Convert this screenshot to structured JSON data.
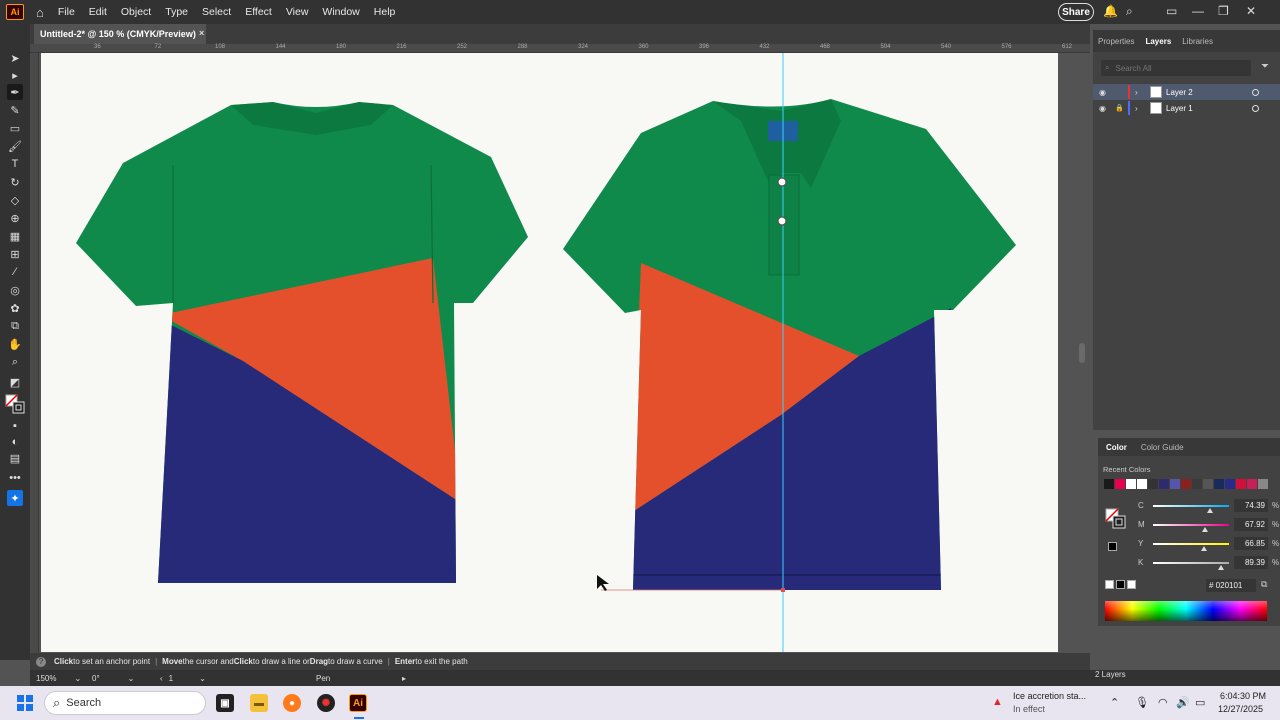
{
  "menubar": {
    "logo": "Ai",
    "items": [
      "File",
      "Edit",
      "Object",
      "Type",
      "Select",
      "Effect",
      "View",
      "Window",
      "Help"
    ],
    "share_label": "Share"
  },
  "document": {
    "tab_title": "Untitled-2* @ 150 % (CMYK/Preview)",
    "close_glyph": "×"
  },
  "ruler": {
    "ticks": [
      "36",
      "72",
      "108",
      "144",
      "180",
      "216",
      "252",
      "288",
      "324",
      "360",
      "396",
      "432",
      "468",
      "504",
      "540",
      "576",
      "612"
    ]
  },
  "hint": {
    "a1": "Click",
    "a2": " to set an anchor point",
    "b1": "Move",
    "b2": " the cursor and ",
    "b3": "Click",
    "b4": " to draw a line or ",
    "b5": "Drag",
    "b6": " to draw a curve",
    "c1": "Enter",
    "c2": " to exit the path",
    "sep": "|"
  },
  "statusbar": {
    "zoom": "150%",
    "rotation": "0°",
    "artboard": "1",
    "tool": "Pen"
  },
  "layers_panel": {
    "tabs": [
      "Properties",
      "Layers",
      "Libraries"
    ],
    "search_placeholder": "Search All",
    "layers": [
      {
        "name": "Layer 2",
        "color": "#e8323c"
      },
      {
        "name": "Layer 1",
        "color": "#4a6cff"
      }
    ],
    "count_label": "2 Layers"
  },
  "color_panel": {
    "tabs": [
      "Color",
      "Color Guide"
    ],
    "recent_label": "Recent Colors",
    "recent_swatches": [
      "#1a1a1a",
      "#e8004c",
      "#ffffff",
      "#ffffff",
      "#333333",
      "#2b2b6e",
      "#5555aa",
      "#8a2020",
      "#3a3a3a",
      "#555555",
      "#1a2a5a",
      "#2a2a8a",
      "#d0103a",
      "#c81e5a",
      "#888888"
    ],
    "sliders": [
      {
        "label": "C",
        "value": "74.39",
        "fraction": 0.7439,
        "track": "#00aeef"
      },
      {
        "label": "M",
        "value": "67.92",
        "fraction": 0.6792,
        "track": "#ec008c"
      },
      {
        "label": "Y",
        "value": "66.85",
        "fraction": 0.6685,
        "track": "#fff200"
      },
      {
        "label": "K",
        "value": "89.39",
        "fraction": 0.8939,
        "track": "#aaaaaa"
      }
    ],
    "percent_sign": "%",
    "hex_value": "020101"
  },
  "taskbar": {
    "search_label": "Search",
    "notification_title": "Ice accretion sta...",
    "notification_sub": "In effect",
    "time": "6:04:30 PM",
    "date": "12/27/2025"
  },
  "colors": {
    "shirt_green": "#0f8a4a",
    "shirt_orange": "#e5502c",
    "shirt_navy": "#262a78",
    "guide": "#3ad0ff",
    "accent": "#1473e6"
  }
}
